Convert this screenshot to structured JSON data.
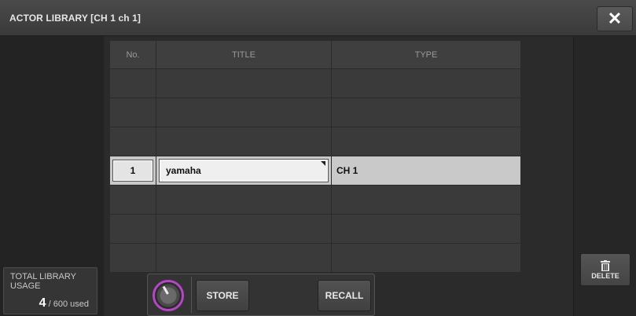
{
  "window": {
    "title": "ACTOR LIBRARY [CH  1 ch 1]",
    "close_icon": "x-close-icon"
  },
  "table": {
    "headers": {
      "no": "No.",
      "title": "TITLE",
      "type": "TYPE"
    },
    "rows": [
      {
        "no": "",
        "title": "",
        "type": ""
      },
      {
        "no": "",
        "title": "",
        "type": ""
      },
      {
        "no": "",
        "title": "",
        "type": ""
      },
      {
        "no": "1",
        "title": "yamaha",
        "type": "CH 1",
        "selected": true
      },
      {
        "no": "",
        "title": "",
        "type": ""
      },
      {
        "no": "",
        "title": "",
        "type": ""
      },
      {
        "no": "",
        "title": "",
        "type": ""
      }
    ]
  },
  "usage": {
    "label": "TOTAL LIBRARY\nUSAGE",
    "count": "4",
    "suffix": "/ 600 used"
  },
  "actions": {
    "store": "STORE",
    "recall": "RECALL",
    "delete": "DELETE"
  },
  "colors": {
    "knob_ring": "#b447c6",
    "selected_row": "#c9c9c9"
  }
}
